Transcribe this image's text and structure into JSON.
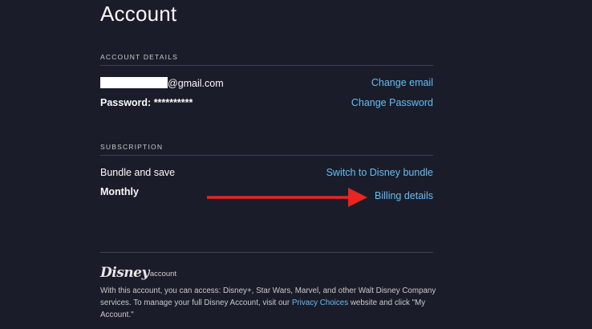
{
  "page": {
    "title": "Account"
  },
  "account_details": {
    "section_label": "ACCOUNT DETAILS",
    "email_suffix": "@gmail.com",
    "password_label": "Password: ",
    "password_mask": "**********",
    "change_email": "Change email",
    "change_password": "Change Password"
  },
  "subscription": {
    "section_label": "SUBSCRIPTION",
    "plan_name": "Bundle and save",
    "billing_cycle": "Monthly",
    "switch_bundle": "Switch to Disney bundle",
    "billing_details": "Billing details"
  },
  "annotation": {
    "arrow_color": "#e8251f",
    "arrow_icon": "red-arrow-right-icon"
  },
  "footer": {
    "logo_brand": "Disney",
    "logo_suffix": "account",
    "text_part1": "With this account, you can access: Disney+, Star Wars, Marvel, and other Walt Disney Company services. To manage your full Disney Account, visit our ",
    "privacy_link": "Privacy Choices",
    "text_part2": " website and click \"My Account.\""
  },
  "colors": {
    "background": "#1a1d29",
    "link": "#67bdf4",
    "text": "#f9f9f9",
    "muted": "#cacaca"
  }
}
